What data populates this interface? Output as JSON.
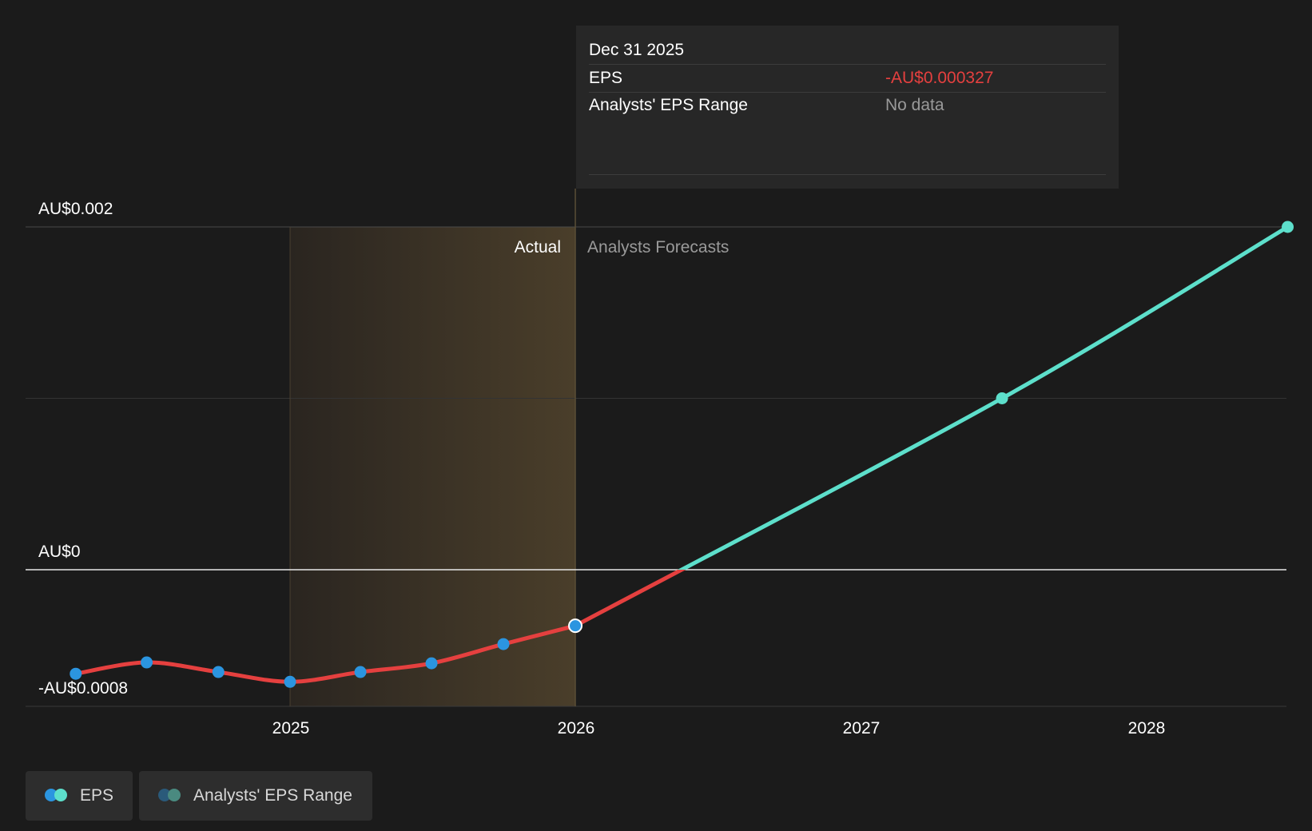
{
  "tooltip": {
    "date": "Dec 31 2025",
    "eps_label": "EPS",
    "eps_value": "-AU$0.000327",
    "range_label": "Analysts' EPS Range",
    "range_value": "No data"
  },
  "labels": {
    "actual": "Actual",
    "forecast": "Analysts Forecasts"
  },
  "legend": {
    "eps": "EPS",
    "range": "Analysts' EPS Range"
  },
  "colors": {
    "actual_line": "#e5403f",
    "forecast_line": "#5ddfcb",
    "actual_point": "#2b95e0",
    "forecast_point": "#5ddfcb",
    "shade_start": "#2a2520",
    "shade_end": "#4a3e2a"
  },
  "chart_data": {
    "type": "line",
    "title": "",
    "xlabel": "",
    "ylabel": "",
    "x_ticks": [
      "2025",
      "2026",
      "2027",
      "2028"
    ],
    "y_ticks": [
      "AU$0.002",
      "AU$0",
      "-AU$0.0008"
    ],
    "ylim": [
      -0.0008,
      0.002
    ],
    "series": [
      {
        "name": "EPS",
        "points": [
          {
            "x": "2024-03-31",
            "y": -0.000607
          },
          {
            "x": "2024-06-30",
            "y": -0.000541
          },
          {
            "x": "2024-09-30",
            "y": -0.000597
          },
          {
            "x": "2024-12-31",
            "y": -0.000654
          },
          {
            "x": "2025-03-31",
            "y": -0.000597
          },
          {
            "x": "2025-06-30",
            "y": -0.000546
          },
          {
            "x": "2025-09-30",
            "y": -0.000434
          },
          {
            "x": "2025-12-31",
            "y": -0.000327
          }
        ]
      },
      {
        "name": "EPS",
        "forecast": true,
        "points": [
          {
            "x": "2025-12-31",
            "y": -0.000327
          },
          {
            "x": "2027-06-30",
            "y": 0.001
          },
          {
            "x": "2028-06-30",
            "y": 0.002
          }
        ]
      }
    ],
    "highlight_x": "2025-12-31",
    "shaded_range": [
      "2024-12-31",
      "2025-12-31"
    ],
    "grid": true,
    "legend_position": "bottom-left"
  }
}
